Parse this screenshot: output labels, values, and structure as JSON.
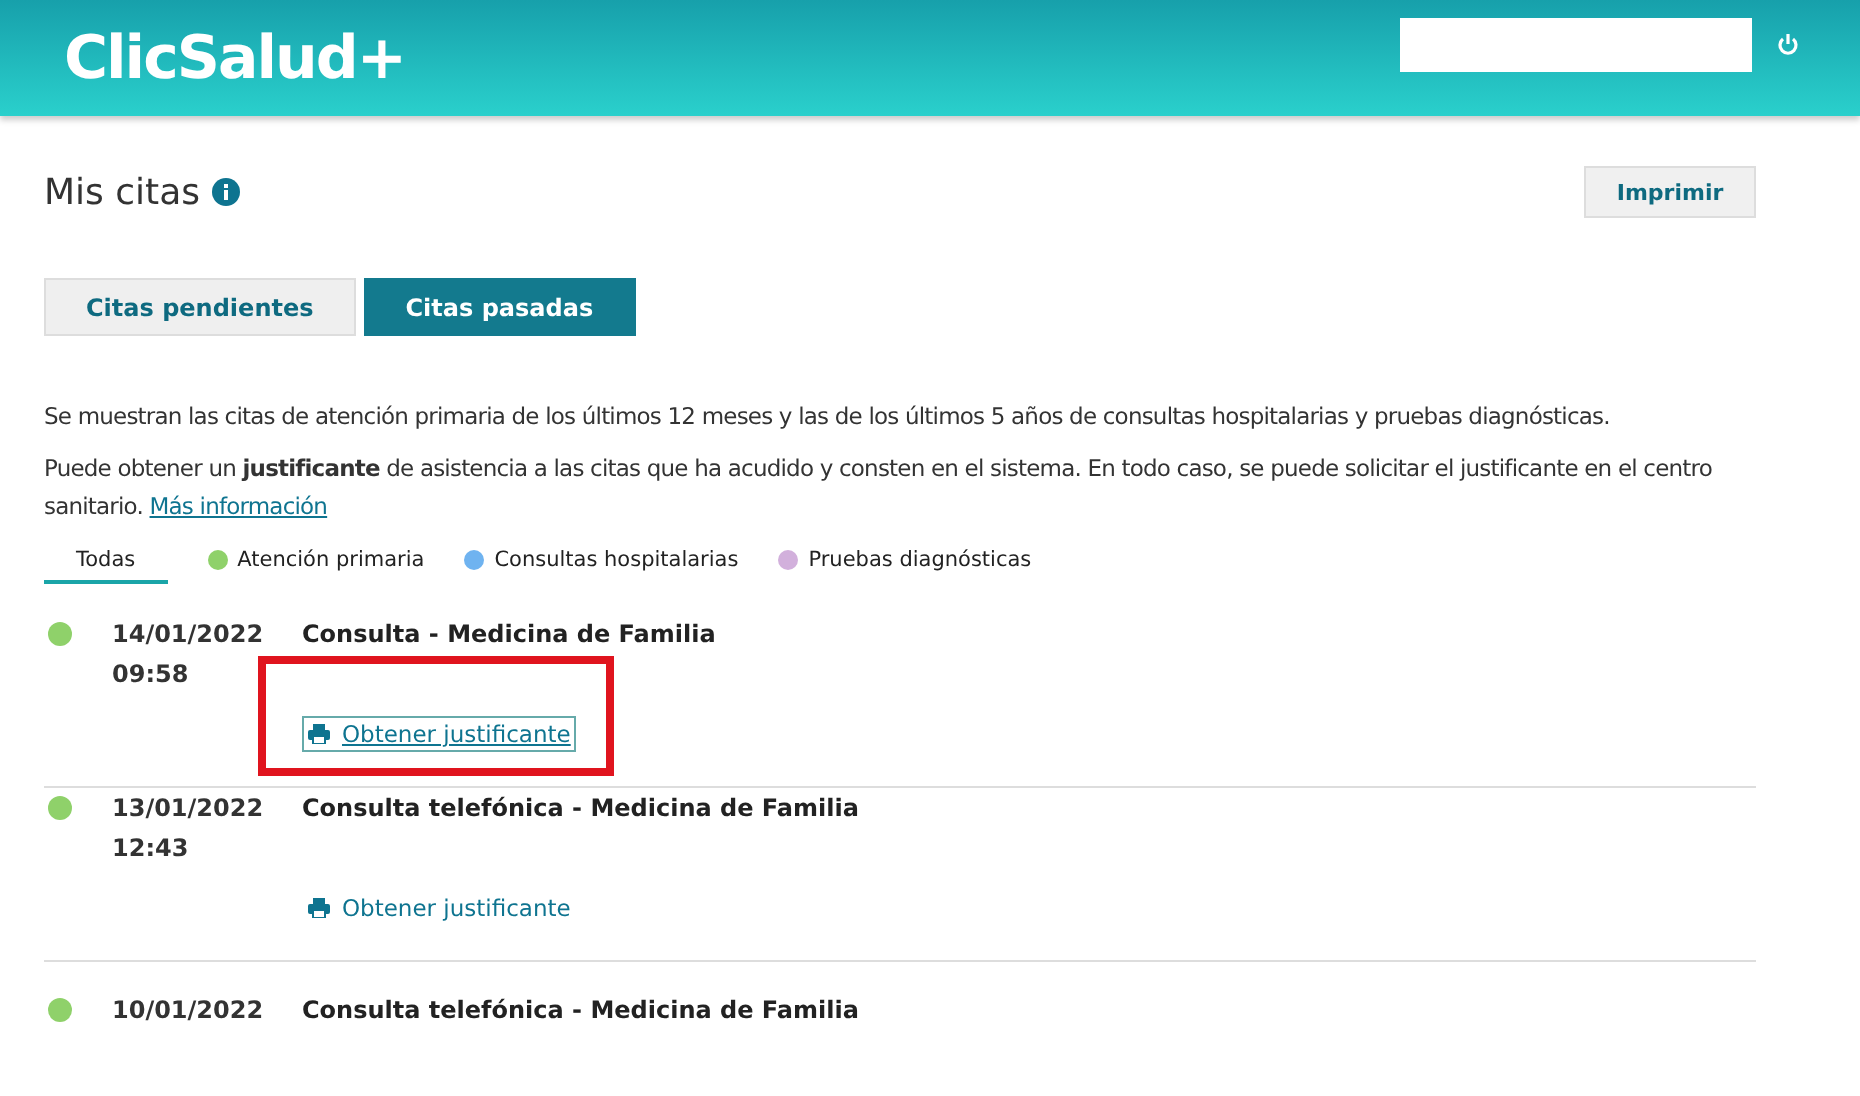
{
  "header": {
    "logo": "ClicSalud+"
  },
  "page": {
    "title": "Mis citas",
    "print_button": "Imprimir"
  },
  "tabs": [
    {
      "label": "Citas pendientes",
      "selected": false
    },
    {
      "label": "Citas pasadas",
      "selected": true
    }
  ],
  "info": [
    "Se muestran las citas de atención primaria de los últimos 12 meses y las de los últimos 5 años de consultas hospitalarias y pruebas diagnósticas.",
    "Puede obtener un **justificante** de asistencia a las citas que ha acudido y consten en el sistema. En todo caso, se puede solicitar el justificante en el centro sanitario."
  ],
  "info_link": "Más información",
  "filters": [
    {
      "label": "Todas",
      "selected": true
    },
    {
      "label": "Atención primaria",
      "selected": false,
      "color": "#8fd16a"
    },
    {
      "label": "Consultas hospitalarias",
      "selected": false,
      "color": "#6fb3f0"
    },
    {
      "label": "Pruebas diagnósticas",
      "selected": false,
      "color": "#d2b0dc"
    }
  ],
  "appointments": [
    {
      "date": "14/01/2022",
      "time": "09:58",
      "title": "Consulta - Medicina de Familia",
      "color": "#8fd16a",
      "link": "Obtener justificante",
      "focused": true,
      "highlighted": true
    },
    {
      "date": "13/01/2022",
      "time": "12:43",
      "title": "Consulta telefónica - Medicina de Familia",
      "color": "#8fd16a",
      "link": "Obtener justificante",
      "focused": false,
      "highlighted": false
    },
    {
      "date": "10/01/2022",
      "title": "Consulta telefónica - Medicina de Familia",
      "color": "#8fd16a"
    }
  ]
}
